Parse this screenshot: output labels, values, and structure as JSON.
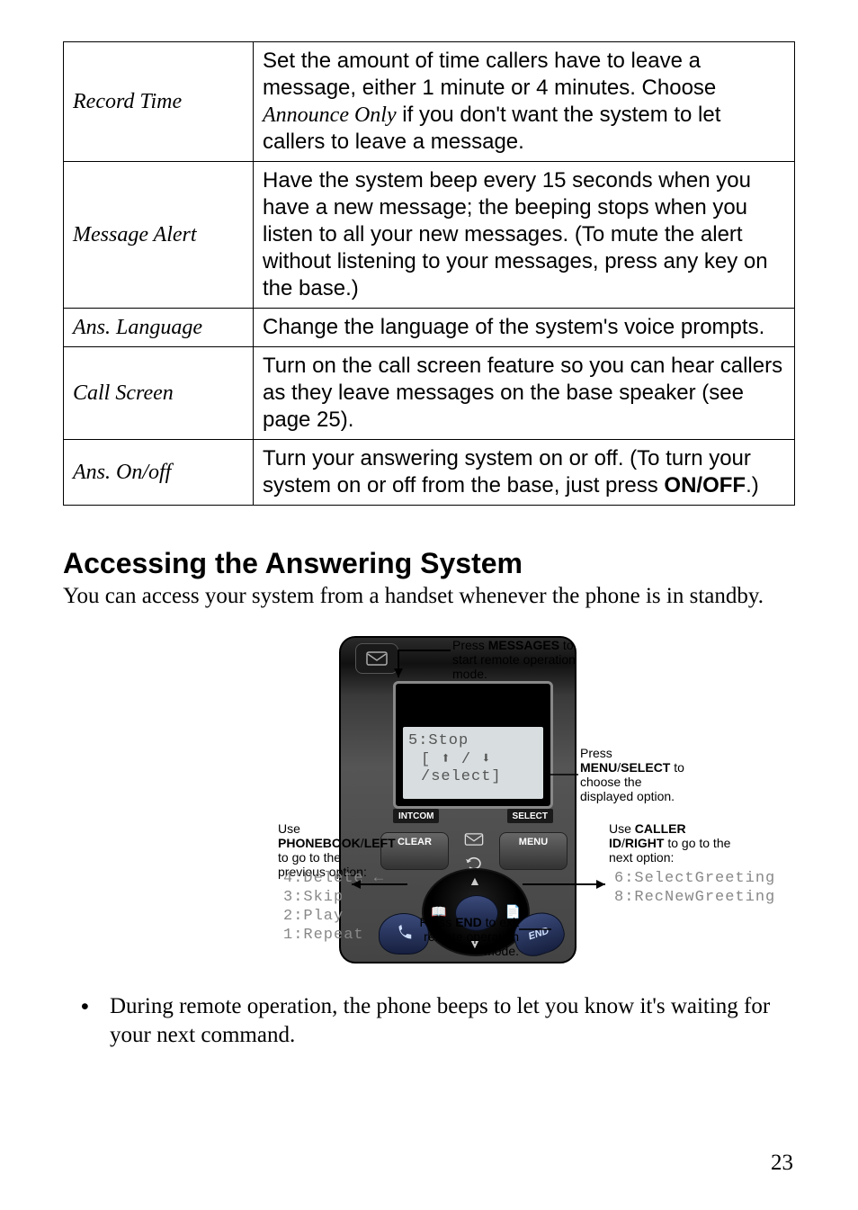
{
  "settings": [
    {
      "label": "Record Time",
      "desc": "Set the amount of time callers have to leave a message, either 1 minute or 4 minutes. Choose <em>Announce Only</em> if you don't want the system to let callers to leave a message."
    },
    {
      "label": "Message Alert",
      "desc": "Have the system beep every 15 seconds when you have a new message; the beeping stops when you listen to all your new messages. (To mute the alert without listening to your messages, press any key on the base.)"
    },
    {
      "label": "Ans. Language",
      "desc": "Change the language of the system's voice prompts."
    },
    {
      "label": "Call Screen",
      "desc": "Turn on the call screen feature so you can hear callers as they leave messages on the base speaker (see page 25)."
    },
    {
      "label": "Ans. On/off",
      "desc": "Turn your answering system on or off. (To turn your system on or off from the base, just press <strong>ON/OFF</strong>.)"
    }
  ],
  "section_heading": "Accessing the Answering System",
  "section_intro": "You can access your system from a handset whenever the phone is in standby.",
  "diagram": {
    "screen_line1": "5:Stop",
    "screen_line2": "[ ⬆ / ⬇ /select]",
    "softkey_left": "INTCOM",
    "softkey_right": "SELECT",
    "btn_clear": "CLEAR",
    "btn_menu": "MENU",
    "btn_end": "END",
    "callout_messages": "Press <strong>MESSAGES</strong> to start remote operation mode.",
    "callout_menu": "Press <strong>MENU</strong>/<strong>SELECT</strong> to choose the displayed option.",
    "callout_left": "Use <strong>PHONEBOOK</strong>/<strong>LEFT</strong> to go to the previous option:",
    "callout_right": "Use <strong>CALLER ID</strong>/<strong>RIGHT</strong> to go to the next option:",
    "callout_end": "Press <strong>END</strong> to exit remote operation mode.",
    "left_options": [
      "4:Delete",
      "3:Skip",
      "2:Play",
      "1:Repeat"
    ],
    "right_options": [
      "6:SelectGreeting",
      "8:RecNewGreeting"
    ]
  },
  "note_bullet": "During remote operation, the phone beeps to let you know it's waiting for your next command.",
  "page_number": "23"
}
